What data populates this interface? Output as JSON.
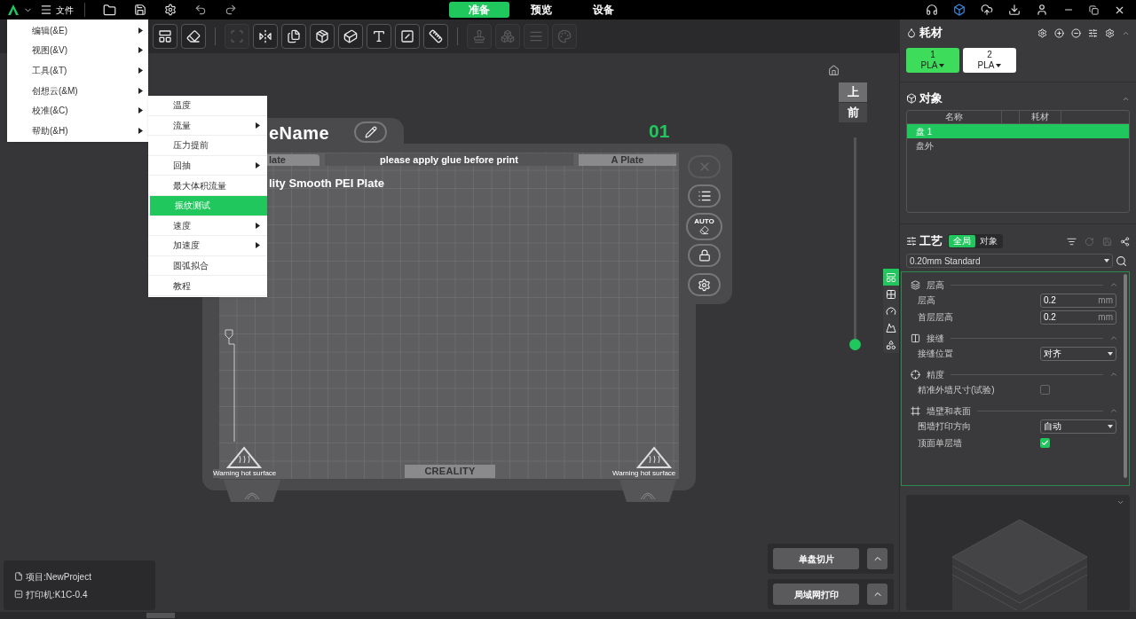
{
  "top_bar": {
    "file_label": "文件",
    "tabs": [
      {
        "label": "准备",
        "selected": true
      },
      {
        "label": "预览",
        "selected": false
      },
      {
        "label": "设备",
        "selected": false
      }
    ]
  },
  "toolbar": {
    "tools": [
      {
        "disabled": false
      },
      {
        "disabled": false
      },
      {
        "disabled": true
      },
      {
        "disabled": false
      },
      {
        "disabled": false
      },
      {
        "disabled": false
      },
      {
        "disabled": false
      },
      {
        "disabled": false
      },
      {
        "disabled": false
      },
      {
        "disabled": false
      },
      {
        "disabled": true
      },
      {
        "disabled": true
      },
      {
        "disabled": true
      },
      {
        "disabled": true
      }
    ]
  },
  "menu": {
    "items": [
      {
        "label": "编辑(&E)",
        "submenu": true
      },
      {
        "label": "视图(&V)",
        "submenu": true
      },
      {
        "label": "工具(&T)",
        "submenu": true
      },
      {
        "label": "创想云(&M)",
        "submenu": true
      },
      {
        "label": "校准(&C)",
        "submenu": true
      },
      {
        "label": "帮助(&H)",
        "submenu": true
      }
    ]
  },
  "submenu": {
    "items": [
      {
        "label": "温度",
        "submenu": false,
        "selected": false
      },
      {
        "label": "流量",
        "submenu": true,
        "selected": false
      },
      {
        "label": "压力提前",
        "submenu": false,
        "selected": false
      },
      {
        "label": "回抽",
        "submenu": true,
        "selected": false
      },
      {
        "label": "最大体积流量",
        "submenu": false,
        "selected": false
      },
      {
        "label": "振纹测试",
        "submenu": false,
        "selected": true
      },
      {
        "label": "速度",
        "submenu": true,
        "selected": false
      },
      {
        "label": "加速度",
        "submenu": true,
        "selected": false
      },
      {
        "label": "圆弧拟合",
        "submenu": false,
        "selected": false
      },
      {
        "label": "教程",
        "submenu": false,
        "selected": false
      }
    ]
  },
  "plate": {
    "name": "eName",
    "number": "01",
    "left_tab": "late",
    "notice": "please apply glue before print",
    "right_tab": "A Plate",
    "type": "lity Smooth PEI Plate",
    "brand": "CREALITY",
    "warnings": [
      "Warning hot surface",
      "Warning hot surface"
    ],
    "auto_label": "AUTO"
  },
  "view_cube": {
    "top": "上",
    "front": "前"
  },
  "layer_slider": {
    "level": 0
  },
  "slice_buttons": [
    "单盘切片",
    "局域网打印"
  ],
  "project_info": {
    "project": "项目:NewProject",
    "printer": "打印机:K1C-0.4"
  },
  "filament": {
    "title": "耗材",
    "slots": [
      {
        "number": "1",
        "material": "PLA",
        "selected": true
      },
      {
        "number": "2",
        "material": "PLA",
        "selected": false
      }
    ]
  },
  "objects": {
    "title": "对象",
    "columns": [
      "名称",
      "耗材"
    ],
    "rows": [
      {
        "name": "盘 1",
        "selected": true
      },
      {
        "name": "盘外",
        "selected": false
      }
    ]
  },
  "process": {
    "title": "工艺",
    "scope_tabs": [
      {
        "label": "全局",
        "selected": true
      },
      {
        "label": "对象",
        "selected": false
      }
    ],
    "preset": "0.20mm Standard",
    "side_tabs": [
      {
        "selected": true
      },
      {
        "selected": false
      },
      {
        "selected": false
      },
      {
        "selected": false
      },
      {
        "selected": false
      }
    ],
    "sections": [
      {
        "title": "层高",
        "expanded": true,
        "settings": [
          {
            "kind": "number",
            "label": "层高",
            "value": "0.2",
            "unit": "mm"
          },
          {
            "kind": "number",
            "label": "首层层高",
            "value": "0.2",
            "unit": "mm"
          }
        ]
      },
      {
        "title": "接缝",
        "expanded": true,
        "settings": [
          {
            "kind": "select",
            "label": "接缝位置",
            "value": "对齐"
          }
        ]
      },
      {
        "title": "精度",
        "expanded": true,
        "settings": [
          {
            "kind": "checkbox",
            "label": "精准外墙尺寸(试验)",
            "checked": false
          }
        ]
      },
      {
        "title": "墙壁和表面",
        "expanded": true,
        "settings": [
          {
            "kind": "select",
            "label": "围墙打印方向",
            "value": "自动"
          },
          {
            "kind": "checkbox",
            "label": "顶面单层墙",
            "checked": true
          }
        ]
      }
    ]
  }
}
